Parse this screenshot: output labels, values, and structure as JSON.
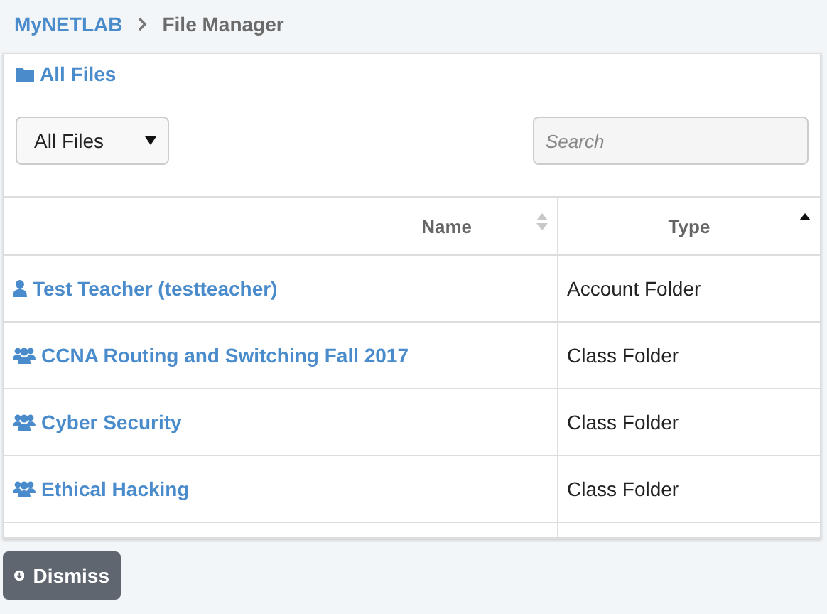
{
  "breadcrumb": [
    {
      "label": "MyNETLAB",
      "link": true
    },
    {
      "label": "File Manager",
      "link": false
    }
  ],
  "card": {
    "title": "All Files",
    "filter": {
      "value": "All Files"
    },
    "search": {
      "placeholder": "Search"
    }
  },
  "table": {
    "columns": [
      {
        "label": "Name",
        "sorted": false
      },
      {
        "label": "Type",
        "sorted": true
      }
    ],
    "rows": [
      {
        "name": "Test Teacher (testteacher)",
        "kind": "user",
        "type": "Account Folder"
      },
      {
        "name": "CCNA Routing and Switching Fall 2017",
        "kind": "group",
        "type": "Class Folder"
      },
      {
        "name": "Cyber Security",
        "kind": "group",
        "type": "Class Folder"
      },
      {
        "name": "Ethical Hacking",
        "kind": "group",
        "type": "Class Folder"
      }
    ]
  },
  "dismiss_button": {
    "label": "Dismiss"
  }
}
